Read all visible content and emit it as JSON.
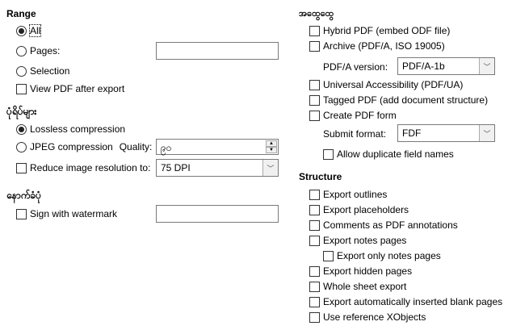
{
  "range": {
    "title": "Range",
    "all": "All",
    "pages": "Pages:",
    "pages_value": "",
    "selection": "Selection",
    "view_pdf": "View PDF after export"
  },
  "images": {
    "title": "ပုံရိပ်များ",
    "lossless": "Lossless compression",
    "jpeg": "JPEG compression",
    "quality_label": "Quality:",
    "quality_value": "၉၀",
    "reduce": "Reduce image resolution to:",
    "resolution": "75 DPI"
  },
  "watermark": {
    "title": "နောက်ခံပုံ",
    "sign": "Sign with watermark",
    "value": ""
  },
  "general": {
    "title": "အထွေထွေ",
    "hybrid": "Hybrid PDF (embed ODF file)",
    "archive": "Archive (PDF/A, ISO 19005)",
    "pdfa_label": "PDF/A version:",
    "pdfa_value": "PDF/A-1b",
    "ua": "Universal Accessibility (PDF/UA)",
    "tagged": "Tagged PDF (add document structure)",
    "form": "Create PDF form",
    "submit_label": "Submit format:",
    "submit_value": "FDF",
    "duplicate": "Allow duplicate field names"
  },
  "structure": {
    "title": "Structure",
    "items": [
      "Export outlines",
      "Export placeholders",
      "Comments as PDF annotations",
      "Export notes pages",
      "Export only notes pages",
      "Export hidden pages",
      "Whole sheet export",
      "Export automatically inserted blank pages",
      "Use reference XObjects"
    ]
  }
}
